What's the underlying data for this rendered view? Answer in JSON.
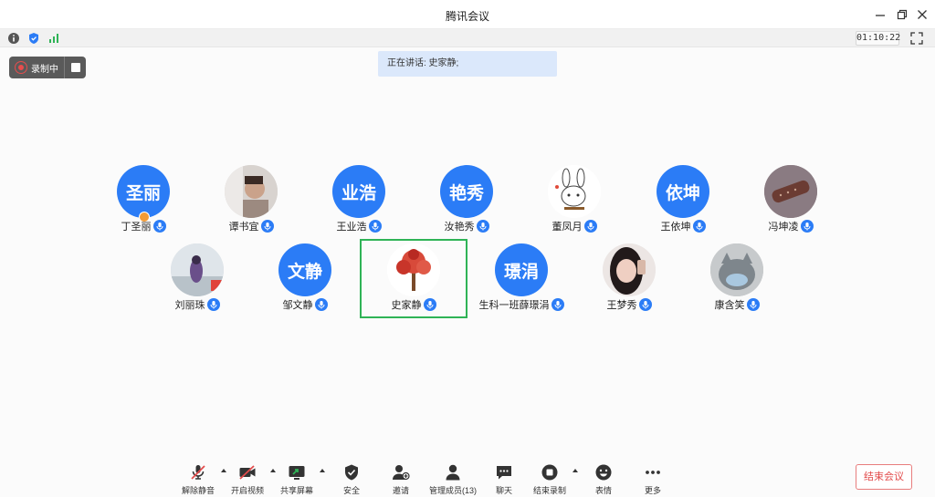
{
  "window": {
    "title": "腾讯会议"
  },
  "infobar": {
    "timer": "01:10:22",
    "icons": [
      "info-icon",
      "shield-icon",
      "signal-icon"
    ]
  },
  "recording": {
    "label": "录制中"
  },
  "speaking": {
    "text": "正在讲话: 史家静;"
  },
  "participants": [
    {
      "name": "丁圣丽",
      "avatar_text": "圣丽",
      "avatar": "text",
      "host": true
    },
    {
      "name": "谭书宜",
      "avatar_text": "",
      "avatar": "photo-child"
    },
    {
      "name": "王业浩",
      "avatar_text": "业浩",
      "avatar": "text"
    },
    {
      "name": "汝艳秀",
      "avatar_text": "艳秀",
      "avatar": "text"
    },
    {
      "name": "董凤月",
      "avatar_text": "",
      "avatar": "photo-bunny"
    },
    {
      "name": "王依坤",
      "avatar_text": "依坤",
      "avatar": "text"
    },
    {
      "name": "冯坤凌",
      "avatar_text": "",
      "avatar": "photo-bar"
    },
    {
      "name": "刘丽珠",
      "avatar_text": "",
      "avatar": "photo-girl"
    },
    {
      "name": "邹文静",
      "avatar_text": "文静",
      "avatar": "text"
    },
    {
      "name": "史家静",
      "avatar_text": "",
      "avatar": "photo-tree",
      "speaking": true
    },
    {
      "name": "生科一班薛璟涓",
      "avatar_text": "璟涓",
      "avatar": "text"
    },
    {
      "name": "王梦秀",
      "avatar_text": "",
      "avatar": "photo-woman"
    },
    {
      "name": "康含笑",
      "avatar_text": "",
      "avatar": "photo-cat"
    }
  ],
  "toolbar": {
    "unmute": "解除静音",
    "video": "开启视频",
    "share": "共享屏幕",
    "security": "安全",
    "invite": "邀请",
    "members": "管理成员(13)",
    "chat": "聊天",
    "stop_record": "结束录制",
    "emoji": "表情",
    "more": "更多",
    "end": "结束会议"
  },
  "colors": {
    "accent": "#2b7cf6",
    "speaking_border": "#2fb356",
    "end": "#e24b4b",
    "banner": "#dbe8fb"
  }
}
